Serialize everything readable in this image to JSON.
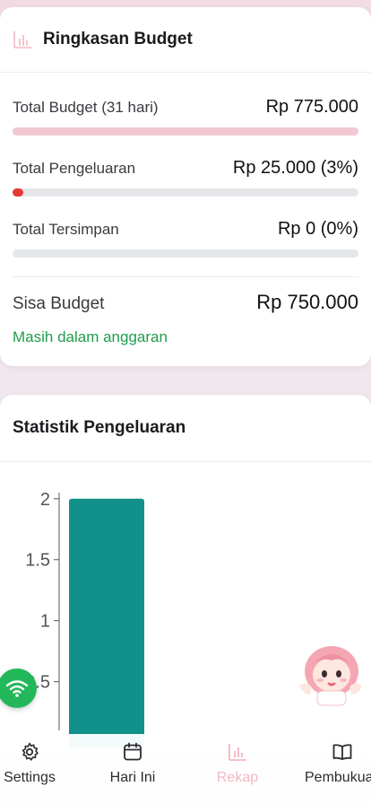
{
  "summary": {
    "title": "Ringkasan Budget",
    "total_budget": {
      "label": "Total Budget (31 hari)",
      "value": "Rp 775.000",
      "progress": 1.0
    },
    "total_pengeluaran": {
      "label": "Total Pengeluaran",
      "value": "Rp 25.000 (3%)",
      "progress": 0.03
    },
    "total_tersimpan": {
      "label": "Total Tersimpan",
      "value": "Rp 0 (0%)",
      "progress": 0.0
    },
    "sisa": {
      "label": "Sisa Budget",
      "value": "Rp 750.000",
      "status": "Masih dalam anggaran"
    }
  },
  "stats": {
    "title": "Statistik Pengeluaran"
  },
  "chart_data": {
    "type": "bar",
    "categories": [
      ""
    ],
    "values": [
      2
    ],
    "y_ticks": [
      "0.5",
      "1",
      "1.5",
      "2"
    ],
    "ylim": [
      0.1,
      2.05
    ],
    "bar_color": "#12918a"
  },
  "nav": {
    "items": [
      {
        "label": "Settings",
        "icon": "gear-icon",
        "active": false
      },
      {
        "label": "Hari Ini",
        "icon": "calendar-icon",
        "active": false
      },
      {
        "label": "Rekap",
        "icon": "bar-chart-icon",
        "active": true
      },
      {
        "label": "Pembukuan",
        "icon": "book-icon",
        "active": false
      }
    ]
  },
  "colors": {
    "accent_pink": "#f2c9d3",
    "expense_red": "#e53935",
    "positive_green": "#1f9d4a",
    "chart_teal": "#12918a",
    "fab_green": "#22b85a"
  }
}
